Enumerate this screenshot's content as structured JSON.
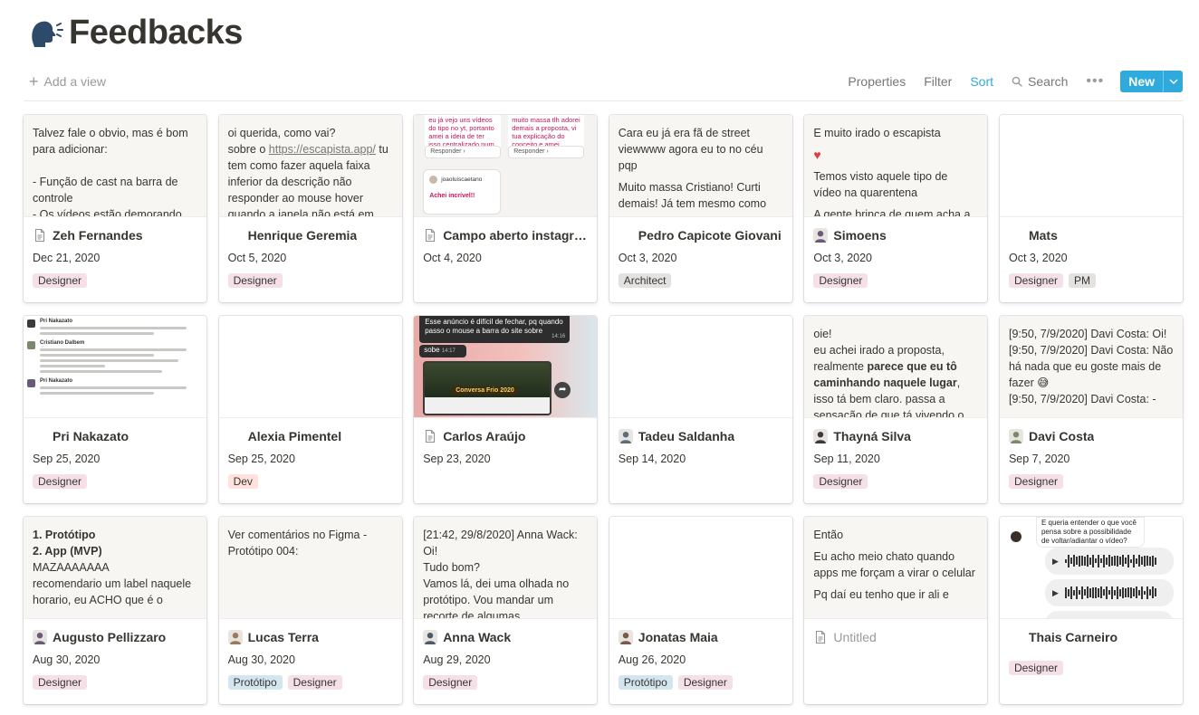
{
  "page": {
    "title": "Feedbacks"
  },
  "toolbar": {
    "add_view": "Add a view",
    "properties": "Properties",
    "filter": "Filter",
    "sort": "Sort",
    "search": "Search",
    "more": "•••",
    "new": "New"
  },
  "colors": {
    "accent": "#2eaadc",
    "tag_designer": "#f5e0e9",
    "tag_gray": "#e3e2e0",
    "tag_dev": "#ffe2dd",
    "tag_prototipo": "#d3e5ef"
  },
  "cards": [
    {
      "name": "Zeh Fernandes",
      "date": "Dec 21, 2020",
      "tags": [
        "Designer"
      ],
      "icon": "page-icon",
      "preview": [
        "Talvez fale o obvio, mas é bom para adicionar:",
        "",
        "- Função de cast na barra de controle",
        "- Os vídeos estão demorando"
      ]
    },
    {
      "name": "Henrique Geremia",
      "date": "Oct 5, 2020",
      "tags": [
        "Designer"
      ],
      "icon": "none",
      "preview": [
        "oi querida, como vai?",
        "sobre o https://escapista.app/ tu tem como fazer aquela faixa inferior da descrição não responder ao mouse hover quando a janela não está em"
      ]
    },
    {
      "name": "Campo aberto instagr…",
      "date": "Oct 4, 2020",
      "tags": [],
      "icon": "page-icon",
      "shot": {
        "left_text": "eu já vejo uns vídeos do tipo no yt, portanto amei a ideia de ter isso centralizado num app",
        "right_text": "muito massa tlh adorei demais a proposta, vi tua explicação do conceito e amei",
        "reply": "Responder",
        "handle": "joaoluiscaetano",
        "message": "Achei incrível!!"
      }
    },
    {
      "name": "Pedro Capicote Giovani",
      "date": "Oct 3, 2020",
      "tags": [
        "Architect"
      ],
      "icon": "none",
      "preview": [
        "Cara eu já era fã de street viewwww agora eu to no céu pqp",
        "Muito massa Cristiano! Curti demais! Já tem mesmo como"
      ]
    },
    {
      "name": "Simoens",
      "date": "Oct 3, 2020",
      "tags": [
        "Designer"
      ],
      "icon": "avatar-icon",
      "preview": [
        "E muito irado o escapista",
        "♥",
        "Temos visto aquele tipo de vídeo na quarentena",
        "A gente brinca de quem acha a"
      ]
    },
    {
      "name": "Mats",
      "date": "Oct 3, 2020",
      "tags": [
        "Designer",
        "PM"
      ],
      "icon": "none",
      "preview": []
    },
    {
      "name": "Pri Nakazato",
      "date": "Sep 25, 2020",
      "tags": [
        "Designer"
      ],
      "icon": "none",
      "chat": {
        "users": [
          "Pri Nakazato",
          "Cristiano Dalbem",
          "Pri Nakazato"
        ]
      }
    },
    {
      "name": "Alexia Pimentel",
      "date": "Sep 25, 2020",
      "tags": [
        "Dev"
      ],
      "icon": "none",
      "preview": []
    },
    {
      "name": "Carlos Araújo",
      "date": "Sep 23, 2020",
      "tags": [],
      "icon": "page-icon",
      "video": {
        "caption": "Esse anúncio é difícil de fechar, pq quando passo o mouse a barra do site sobre",
        "time1": "14:16",
        "word": "sobe",
        "time2": "14:17",
        "banner": "Conversa Frio 2020"
      }
    },
    {
      "name": "Tadeu Saldanha",
      "date": "Sep 14, 2020",
      "tags": [],
      "icon": "avatar-icon",
      "preview": []
    },
    {
      "name": "Thayná Silva",
      "date": "Sep 11, 2020",
      "tags": [
        "Designer"
      ],
      "icon": "avatar-icon",
      "preview_html": "oie!\neu achei irado a proposta, realmente <b>parece que eu tô caminhando naquele lugar</b>, isso tá bem claro. passa a sensação de que tá vivendo o"
    },
    {
      "name": "Davi Costa",
      "date": "Sep 7, 2020",
      "tags": [
        "Designer"
      ],
      "icon": "avatar-icon",
      "preview": [
        "[9:50, 7/9/2020] Davi Costa: Oi!",
        "[9:50, 7/9/2020] Davi Costa: Não há nada que eu goste mais de fazer 😅",
        "[9:50, 7/9/2020] Davi Costa: -"
      ]
    },
    {
      "name": "Augusto Pellizzaro",
      "date": "Aug 30, 2020",
      "tags": [
        "Designer"
      ],
      "icon": "avatar-icon",
      "preview_html": "<b>1. Protótipo</b>\n<b>2. App (MVP)</b>\nMAZAAAAAAA\nrecomendario um label naquele horario, eu ACHO que é o"
    },
    {
      "name": "Lucas Terra",
      "date": "Aug 30, 2020",
      "tags": [
        "Protótipo",
        "Designer"
      ],
      "icon": "avatar-icon",
      "preview": [
        "Ver comentários no Figma - Protótipo 004:"
      ]
    },
    {
      "name": "Anna Wack",
      "date": "Aug 29, 2020",
      "tags": [
        "Designer"
      ],
      "icon": "avatar-icon",
      "preview": [
        "[21:42, 29/8/2020] Anna Wack: Oi!\nTudo bom?\nVamos lá, dei uma olhada no protótipo. Vou mandar um recorte de algumas"
      ]
    },
    {
      "name": "Jonatas Maia",
      "date": "Aug 26, 2020",
      "tags": [
        "Protótipo",
        "Designer"
      ],
      "icon": "avatar-icon",
      "preview": []
    },
    {
      "name": "Untitled",
      "date": "",
      "tags": [],
      "icon": "page-icon",
      "muted": true,
      "preview": [
        "Então",
        "Eu acho meio chato quando apps me forçam a virar o celular",
        "Pq daí eu tenho que ir ali e"
      ]
    },
    {
      "name": "Thais Carneiro",
      "date": "",
      "tags": [
        "Designer"
      ],
      "icon": "none",
      "audio": {
        "text": "E queria entender o que você pensa sobre a possibilidade de voltar/adiantar o vídeo?"
      }
    }
  ]
}
